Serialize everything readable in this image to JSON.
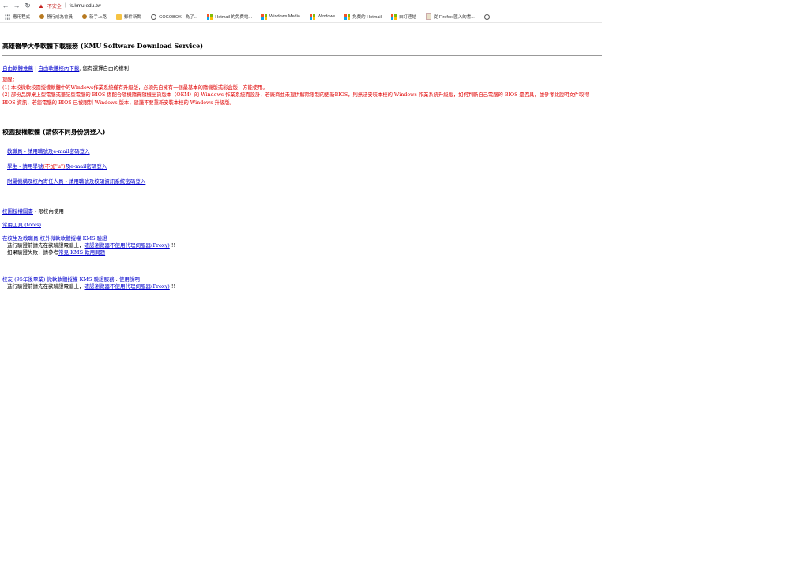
{
  "browser": {
    "insecure_label": "不安全",
    "url": "fs.kmu.edu.tw",
    "bookmarks": [
      {
        "icon": "apps-icon",
        "label": "應用程式"
      },
      {
        "icon": "favicon-icon",
        "label": "勝行成為會員"
      },
      {
        "icon": "favicon-icon",
        "label": "新手上路"
      },
      {
        "icon": "folder-icon",
        "label": "郵件新聞"
      },
      {
        "icon": "globe-icon",
        "label": "GOGOBOX - 為了..."
      },
      {
        "icon": "windows-icon",
        "label": "Hotmail 的免費電..."
      },
      {
        "icon": "windows-icon",
        "label": "Windows Media"
      },
      {
        "icon": "windows-icon",
        "label": "Windows"
      },
      {
        "icon": "windows-icon",
        "label": "免費的 Hotmail"
      },
      {
        "icon": "windows-icon",
        "label": "自訂連結"
      },
      {
        "icon": "doc-icon",
        "label": "從 Firefox 匯入的書..."
      }
    ]
  },
  "page": {
    "title": "高雄醫學大學軟體下載服務 (KMU Software Download Service)",
    "links": {
      "link1": "自由軟體推薦",
      "divider": " | ",
      "link2": "自由軟體校內下載",
      "suffix": ", 您有選擇自由的權利"
    },
    "notice": {
      "heading": "提醒：",
      "line1": "(1) 本校微軟校園授權軟體中的Windows作業系統僅有升級版，必須先自擁有一個最基本的隨機版或彩盒版，方能使用。",
      "line2": "(2) 部份品牌桌上型電腦或筆記型電腦的 BIOS 係配合隨機隨買隨機出貨版本（OEM）的 Windows 作業系統而設計，若廠商並未提供解除限制的更新BIOS，則無法安裝本校的 Windows 作業系統升級版，如何判斷自己電腦的 BIOS 是否具，並參考此說明文件取得 BIOS 資訊，若您電腦的 BIOS 已被限制 Windows 版本，建議不要重新安裝本校的 Windows 升級版。"
    },
    "section_title": "校園授權軟體 (請依不同身份別登入)",
    "login_links": {
      "faculty": "教職員 - 請用職號及e-mail密碼登入",
      "student_prefix": "學生 - 請用學號",
      "student_note": "(不加\"u\")",
      "student_suffix": "及e-mail密碼登入",
      "affiliate": "附屬機構及校內寄任人員 - 請用職號及校碩資訊系統密碼登入"
    },
    "license_library": {
      "link": "校園授權圖書",
      "suffix": " - 限校內使用"
    },
    "tools": {
      "link": "常用工具 (tools)"
    },
    "kms_onsite": {
      "link": "在校生及教職員 校外微軟軟體授權 KMS 驗證",
      "line1_prefix": "進行驗證前請先在欲驗證電腦上，",
      "line1_link": "確認瀏覽器不使用代理伺服器(Proxy)",
      "line1_suffix": " !!",
      "line2_prefix": "如果驗證失敗，請參考",
      "line2_link": "常見 KMS 軟用問題"
    },
    "kms_alumni": {
      "link1": "校友 (95年後畢業) 微軟軟體授權 KMS 驗證服務",
      "divider": " : ",
      "link2": "使用說明",
      "line1_prefix": "進行驗證前請先在欲驗證電腦上，",
      "line1_link": "確認瀏覽器不使用代理伺服器(Proxy)",
      "line1_suffix": " !!"
    }
  }
}
